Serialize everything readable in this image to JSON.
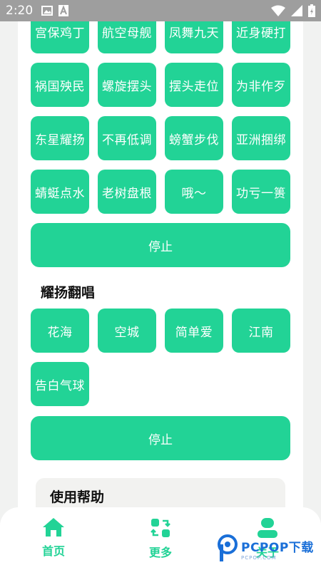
{
  "status_bar": {
    "time": "2:20"
  },
  "grid_top": [
    "宫保鸡丁",
    "航空母舰",
    "凤舞九天",
    "近身硬打",
    "祸国殃民",
    "螺旋摆头",
    "摆头走位",
    "为非作歹",
    "东星耀扬",
    "不再低调",
    "螃蟹步伐",
    "亚洲捆绑",
    "蜻蜓点水",
    "老树盘根",
    "哦～",
    "功亏一篑"
  ],
  "stop_label_1": "停止",
  "section_title": "耀扬翻唱",
  "grid_songs": [
    "花海",
    "空城",
    "简单爱",
    "江南",
    "告白气球"
  ],
  "stop_label_2": "停止",
  "help": {
    "title": "使用帮助"
  },
  "nav": {
    "items": [
      {
        "label": "首页",
        "icon": "home-icon"
      },
      {
        "label": "更多",
        "icon": "swap-icon"
      },
      {
        "label": "关于",
        "icon": "user-icon"
      }
    ]
  },
  "watermark": {
    "main": "PCPOP下载",
    "sub": "PCPOP.COM"
  },
  "colors": {
    "accent": "#22d396",
    "status_bar": "#9e9e9e",
    "background": "#f1f2f1"
  }
}
